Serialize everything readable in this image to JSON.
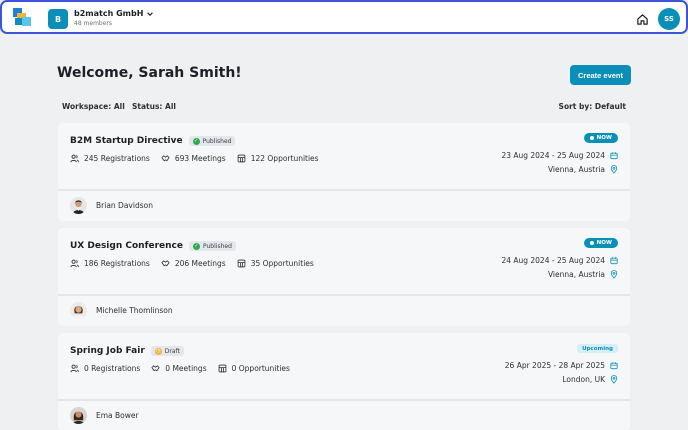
{
  "workspace": {
    "badge": "B",
    "name": "b2match GmbH",
    "members": "48 members"
  },
  "user": {
    "initials": "SS"
  },
  "welcome": "Welcome, Sarah Smith!",
  "create_label": "Create event",
  "filters": {
    "workspace": "Workspace: All",
    "status": "Status: All",
    "sort": "Sort by: Default"
  },
  "colors": {
    "accent": "#0a8fb8",
    "published": "#2fa84f",
    "draft": "#f3b334",
    "topbar_border": "#3c55d8"
  },
  "events": [
    {
      "title": "B2M Startup Directive",
      "status": "Published",
      "pill": "NOW",
      "registrations": "245 Registrations",
      "meetings": "693 Meetings",
      "opportunities": "122 Opportunities",
      "dates": "23 Aug 2024 - 25 Aug 2024",
      "location": "Vienna, Austria",
      "organizer": "Brian Davidson"
    },
    {
      "title": "UX Design Conference",
      "status": "Published",
      "pill": "NOW",
      "registrations": "186 Registrations",
      "meetings": "206 Meetings",
      "opportunities": "35 Opportunities",
      "dates": "24 Aug 2024 - 25 Aug 2024",
      "location": "Vienna, Austria",
      "organizer": "Michelle Thomlinson"
    },
    {
      "title": "Spring Job Fair",
      "status": "Draft",
      "pill": "Upcoming",
      "registrations": "0 Registrations",
      "meetings": "0 Meetings",
      "opportunities": "0 Opportunities",
      "dates": "26 Apr 2025 - 28 Apr 2025",
      "location": "London, UK",
      "organizer": "Ema Bower"
    }
  ]
}
